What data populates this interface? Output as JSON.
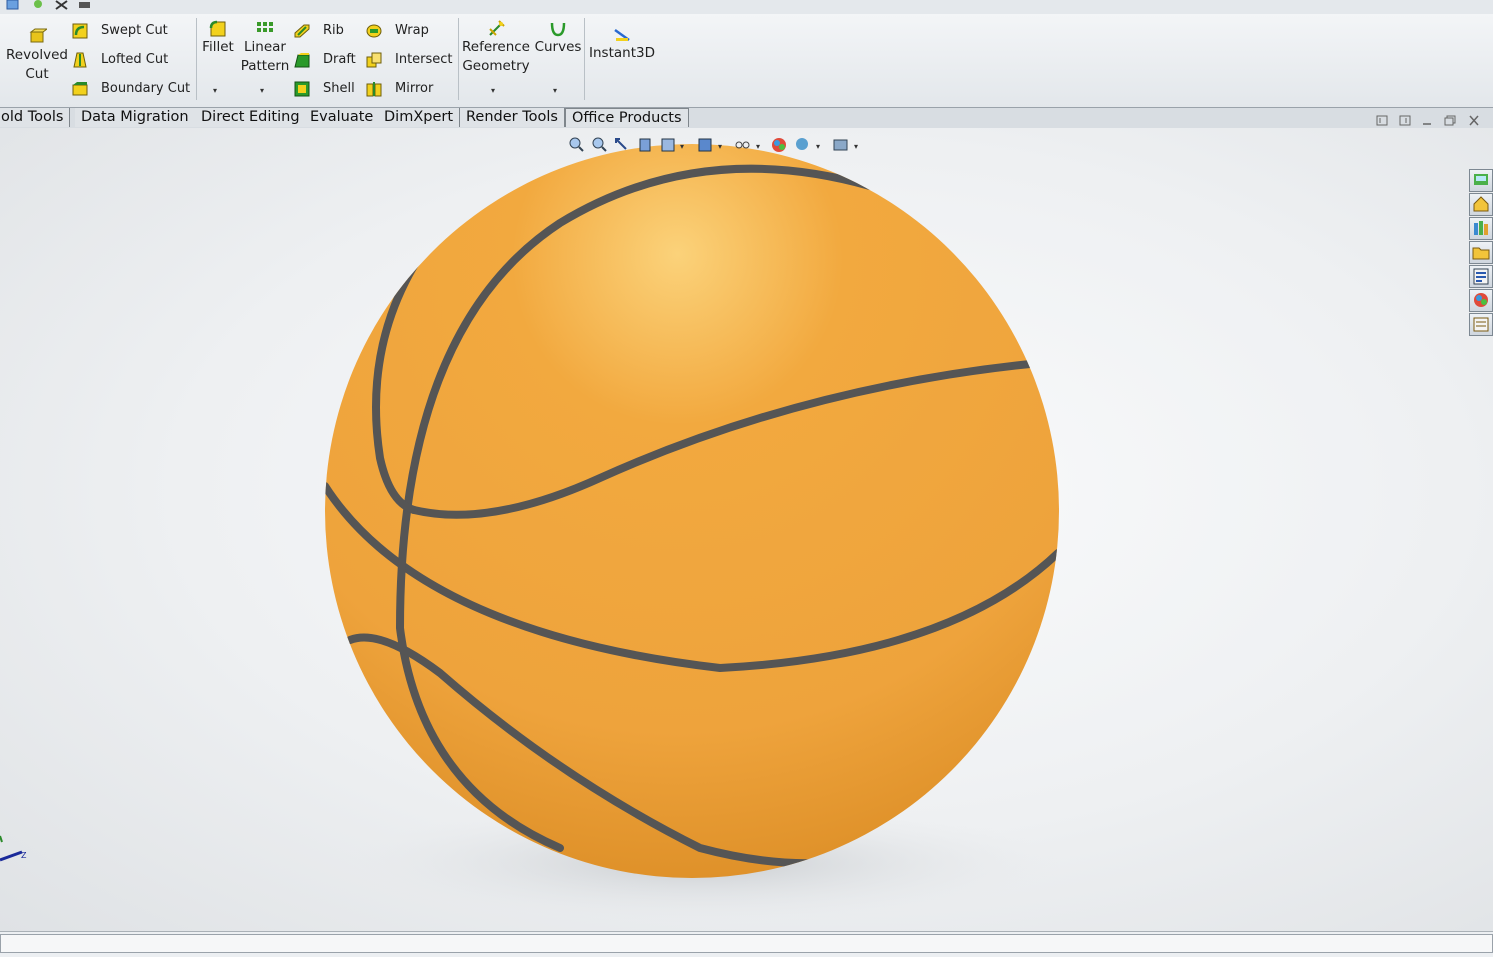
{
  "ribbon": {
    "revolved_cut": "Revolved\nCut",
    "swept_cut": "Swept Cut",
    "lofted_cut": "Lofted Cut",
    "boundary_cut": "Boundary Cut",
    "fillet": "Fillet",
    "linear_pattern": "Linear\nPattern",
    "rib": "Rib",
    "draft": "Draft",
    "shell": "Shell",
    "wrap": "Wrap",
    "intersect": "Intersect",
    "mirror": "Mirror",
    "reference_geometry": "Reference\nGeometry",
    "curves": "Curves",
    "instant3d": "Instant3D"
  },
  "tabs": [
    "lold Tools",
    "Data Migration",
    "Direct Editing",
    "Evaluate",
    "DimXpert",
    "Render Tools",
    "Office Products"
  ],
  "heads_up_icons": [
    "zoom-to-fit-icon",
    "zoom-to-area-icon",
    "previous-view-icon",
    "section-view-icon",
    "view-orientation-icon",
    "display-style-icon",
    "hide-show-items-icon",
    "edit-appearance-icon",
    "apply-scene-icon",
    "view-settings-icon"
  ],
  "task_pane_icons": [
    "solidworks-resources-icon",
    "home-icon",
    "design-library-icon",
    "file-explorer-icon",
    "view-palette-icon",
    "appearances-icon",
    "custom-properties-icon"
  ],
  "colors": {
    "ball_orange": "#f0a43e",
    "seam": "#555555",
    "ribbon_bg": "#eef1f4",
    "tab_bg": "#dfe3e7"
  }
}
